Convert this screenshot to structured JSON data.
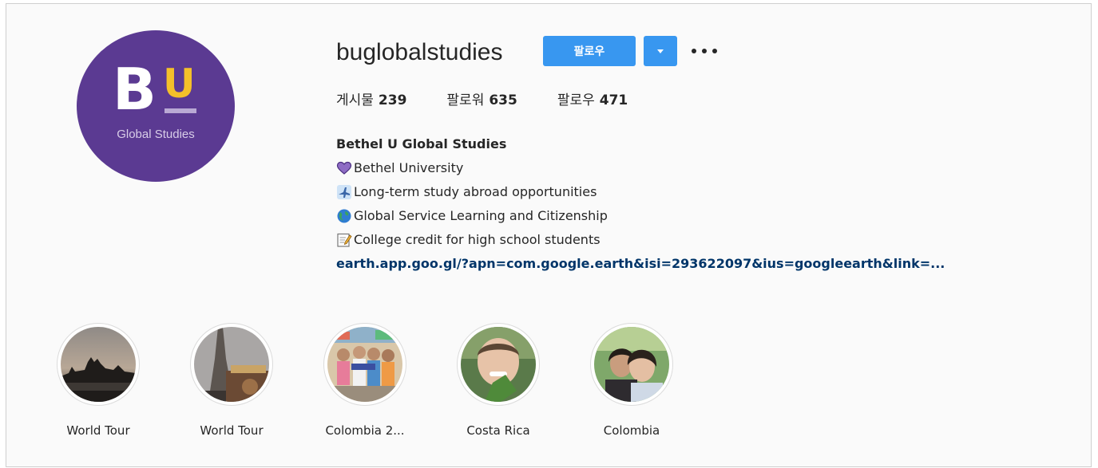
{
  "profile": {
    "username": "buglobalstudies",
    "avatar_logo_letters": "BU",
    "avatar_subtitle": "Global Studies",
    "follow_label": "팔로우",
    "dropdown_icon": "chevron-down-icon",
    "more_icon": "more-options-icon"
  },
  "stats": {
    "posts_label": "게시물",
    "posts_count": "239",
    "followers_label": "팔로워",
    "followers_count": "635",
    "following_label": "팔로우",
    "following_count": "471"
  },
  "bio": {
    "name": "Bethel U Global Studies",
    "lines": [
      {
        "icon": "purple-heart-icon",
        "text": "Bethel University"
      },
      {
        "icon": "airplane-icon",
        "text": "Long-term study abroad opportunities"
      },
      {
        "icon": "globe-icon",
        "text": "Global Service Learning and Citizenship"
      },
      {
        "icon": "memo-icon",
        "text": "College credit for high school students"
      }
    ],
    "link": "earth.app.goo.gl/?apn=com.google.earth&isi=293622097&ius=googleearth&link=..."
  },
  "highlights": [
    {
      "label": "World Tour"
    },
    {
      "label": "World Tour"
    },
    {
      "label": "Colombia 2..."
    },
    {
      "label": "Costa Rica"
    },
    {
      "label": "Colombia"
    }
  ],
  "colors": {
    "accent": "#3897f0",
    "link": "#003569",
    "avatar_bg": "#5b3a92",
    "logo_u": "#f4c02a"
  }
}
